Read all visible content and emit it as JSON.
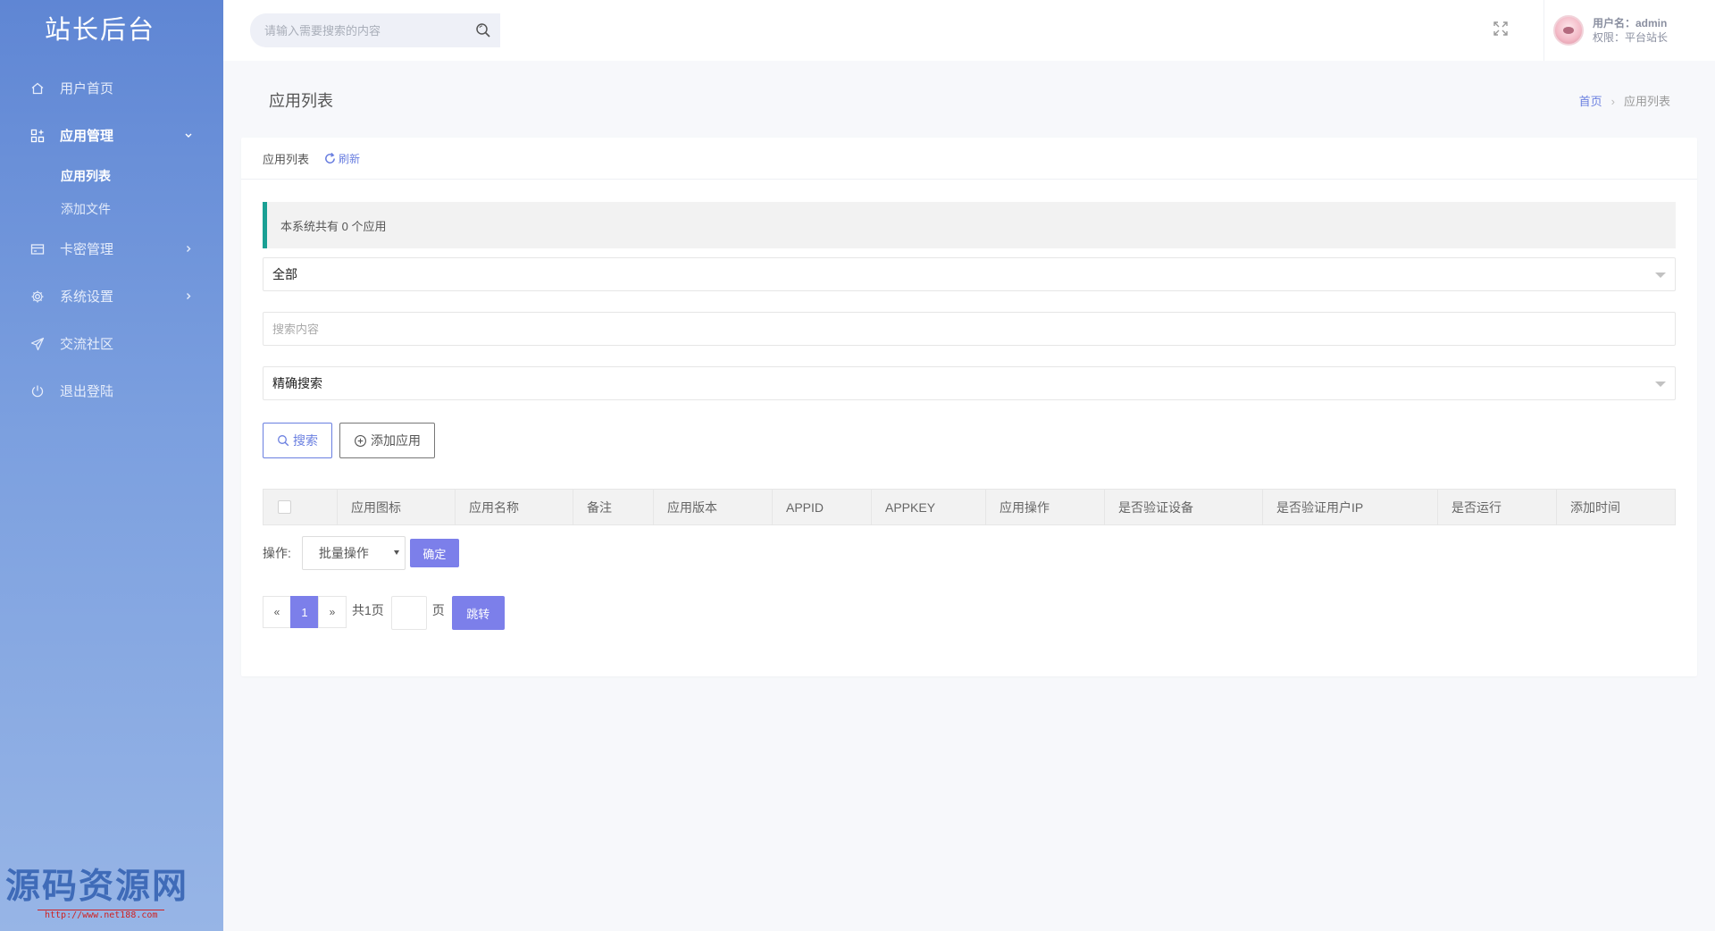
{
  "sidebar": {
    "brand": "站长后台",
    "items": [
      {
        "label": "用户首页",
        "icon": "home-icon"
      },
      {
        "label": "应用管理",
        "icon": "apps-icon"
      },
      {
        "label": "卡密管理",
        "icon": "card-icon"
      },
      {
        "label": "系统设置",
        "icon": "gear-icon"
      },
      {
        "label": "交流社区",
        "icon": "send-icon"
      },
      {
        "label": "退出登陆",
        "icon": "power-icon"
      }
    ],
    "sub_items": [
      {
        "label": "应用列表"
      },
      {
        "label": "添加文件"
      }
    ]
  },
  "watermark": {
    "title": "源码资源网",
    "url": "http://www.net188.com"
  },
  "header": {
    "search_placeholder": "请输入需要搜索的内容",
    "user_name": "用户名：admin",
    "user_role": "权限：平台站长"
  },
  "page": {
    "title": "应用列表",
    "breadcrumb_home": "首页",
    "breadcrumb_current": "应用列表"
  },
  "card": {
    "tab_label": "应用列表",
    "refresh_label": "刷新",
    "notice": "本系统共有 0 个应用",
    "filter_select": "全部",
    "search_placeholder": "搜索内容",
    "mode_select": "精确搜索",
    "search_button": "搜索",
    "add_button": "添加应用"
  },
  "table": {
    "columns": [
      "应用图标",
      "应用名称",
      "备注",
      "应用版本",
      "APPID",
      "APPKEY",
      "应用操作",
      "是否验证设备",
      "是否验证用户IP",
      "是否运行",
      "添加时间"
    ]
  },
  "batch": {
    "label": "操作:",
    "select_value": "批量操作",
    "confirm": "确定"
  },
  "pager": {
    "prev": "«",
    "current": "1",
    "next": "»",
    "total": "共1页",
    "unit": "页",
    "jump": "跳转"
  },
  "colors": {
    "accent": "#7c7fea",
    "link": "#6a7fe0",
    "notice_border": "#1aa094",
    "sidebar_top": "#5f86d4",
    "sidebar_bottom": "#97b5e6"
  }
}
